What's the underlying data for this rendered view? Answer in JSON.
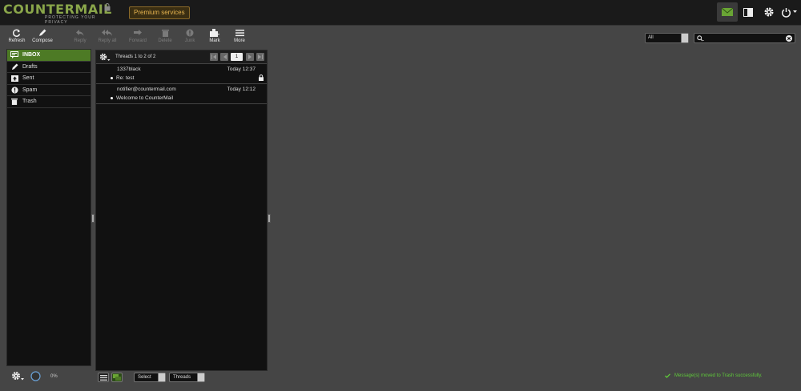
{
  "header": {
    "logo_text": "COUNTERMAIL",
    "logo_tagline": "PROTECTING YOUR PRIVACY",
    "premium_label": "Premium services",
    "icons": [
      "mail-icon",
      "layout-icon",
      "gear-icon",
      "power-icon"
    ]
  },
  "toolbar": {
    "refresh": "Refresh",
    "compose": "Compose",
    "reply": "Reply",
    "reply_all": "Reply all",
    "forward": "Forward",
    "delete": "Delete",
    "junk": "Junk",
    "mark": "Mark",
    "more": "More"
  },
  "search": {
    "filter_value": "All",
    "placeholder": ""
  },
  "folders": [
    {
      "label": "INBOX",
      "icon": "inbox-icon",
      "active": true
    },
    {
      "label": "Drafts",
      "icon": "pencil-icon"
    },
    {
      "label": "Sent",
      "icon": "sent-icon"
    },
    {
      "label": "Spam",
      "icon": "spam-icon"
    },
    {
      "label": "Trash",
      "icon": "trash-icon"
    }
  ],
  "quota": {
    "percent_text": "0%",
    "percent": 0
  },
  "message_list": {
    "threads_info": "Threads 1 to 2 of 2",
    "page": "1",
    "messages": [
      {
        "from": "1337black",
        "date": "Today 12:37",
        "subject": "Re: test",
        "encrypted": true
      },
      {
        "from": "notifier@countermail.com",
        "date": "Today 12:12",
        "subject": "Welcome to CounterMail",
        "encrypted": false
      }
    ]
  },
  "list_footer": {
    "select_label": "Select",
    "threads_label": "Threads"
  },
  "status": {
    "message": "Message(s) moved to Trash successfully.",
    "color": "#5fc93a"
  },
  "colors": {
    "accent": "#4d7a25",
    "brand": "#8aa64a",
    "premium": "#e6b450"
  }
}
